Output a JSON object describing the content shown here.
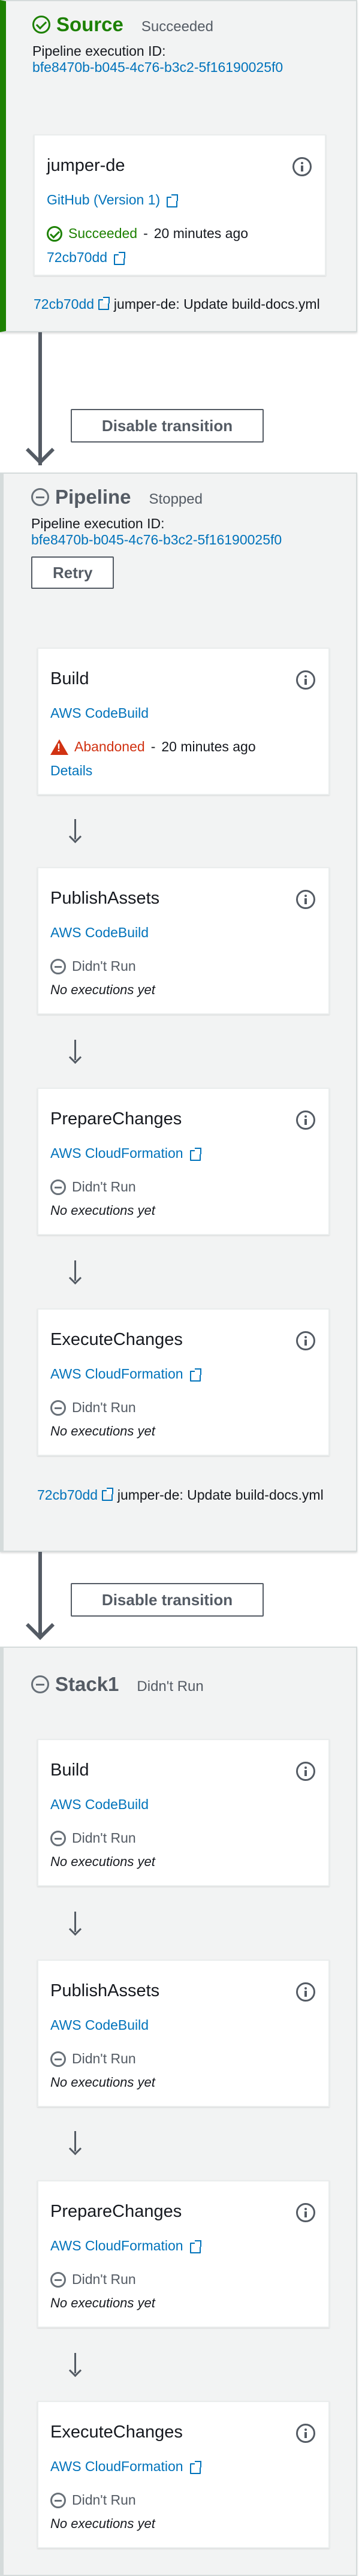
{
  "stages": [
    {
      "name": "Source",
      "status": "Succeeded",
      "exec_label": "Pipeline execution ID:",
      "exec_id": "bfe8470b-b045-4c76-b3c2-5f16190025f0",
      "actions": [
        {
          "name": "jumper-de",
          "provider": "GitHub (Version 1)",
          "status": "Succeeded",
          "time": "20 minutes ago",
          "sub_link": "72cb70dd"
        }
      ],
      "commit_hash": "72cb70dd",
      "commit_msg": "jumper-de: Update build-docs.yml"
    },
    {
      "name": "Pipeline",
      "status": "Stopped",
      "exec_label": "Pipeline execution ID:",
      "exec_id": "bfe8470b-b045-4c76-b3c2-5f16190025f0",
      "retry_label": "Retry",
      "actions": [
        {
          "name": "Build",
          "provider": "AWS CodeBuild",
          "status": "Abandoned",
          "time": "20 minutes ago",
          "sub_link": "Details"
        },
        {
          "name": "PublishAssets",
          "provider": "AWS CodeBuild",
          "status": "Didn't Run",
          "sub_text": "No executions yet"
        },
        {
          "name": "PrepareChanges",
          "provider": "AWS CloudFormation",
          "status": "Didn't Run",
          "sub_text": "No executions yet"
        },
        {
          "name": "ExecuteChanges",
          "provider": "AWS CloudFormation",
          "status": "Didn't Run",
          "sub_text": "No executions yet"
        }
      ],
      "commit_hash": "72cb70dd",
      "commit_msg": "jumper-de: Update build-docs.yml"
    },
    {
      "name": "Stack1",
      "status": "Didn't Run",
      "actions": [
        {
          "name": "Build",
          "provider": "AWS CodeBuild",
          "status": "Didn't Run",
          "sub_text": "No executions yet"
        },
        {
          "name": "PublishAssets",
          "provider": "AWS CodeBuild",
          "status": "Didn't Run",
          "sub_text": "No executions yet"
        },
        {
          "name": "PrepareChanges",
          "provider": "AWS CloudFormation",
          "status": "Didn't Run",
          "sub_text": "No executions yet"
        },
        {
          "name": "ExecuteChanges",
          "provider": "AWS CloudFormation",
          "status": "Didn't Run",
          "sub_text": "No executions yet"
        }
      ]
    }
  ],
  "transitions": [
    {
      "label": "Disable transition"
    },
    {
      "label": "Disable transition"
    }
  ],
  "separator": "-",
  "colors": {
    "success": "#1d8102",
    "error": "#d13212",
    "link": "#0073bb",
    "muted": "#545b64"
  }
}
